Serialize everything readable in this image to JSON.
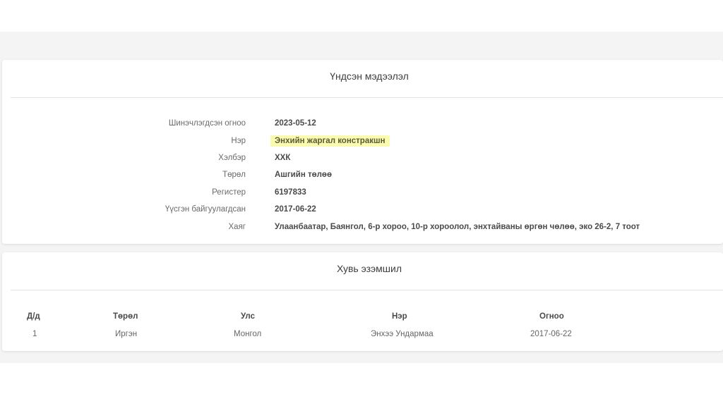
{
  "basic_info": {
    "title": "Үндсэн мэдээлэл",
    "rows": [
      {
        "label": "Шинэчлэгдсэн огноо",
        "value": "2023-05-12"
      },
      {
        "label": "Нэр",
        "value": "Энхийн жаргал констракшн"
      },
      {
        "label": "Хэлбэр",
        "value": "ХХК"
      },
      {
        "label": "Төрөл",
        "value": "Ашгийн төлөө"
      },
      {
        "label": "Регистер",
        "value": "6197833"
      },
      {
        "label": "Үүсгэн байгуулагдсан",
        "value": "2017-06-22"
      },
      {
        "label": "Хаяг",
        "value": "Улаанбаатар, Баянгол, 6-р хороо, 10-р хороолол, энхтайваны өргөн чөлөө, эко 26-2, 7 тоот"
      }
    ],
    "highlight_color": "#fbfbb0"
  },
  "ownership": {
    "title": "Хувь эзэмшил",
    "headers": [
      "Д/д",
      "Төрөл",
      "Улс",
      "Нэр",
      "Огноо"
    ],
    "rows": [
      [
        "1",
        "Иргэн",
        "Монгол",
        "Энхээ Ундармаа",
        "2017-06-22"
      ]
    ]
  }
}
